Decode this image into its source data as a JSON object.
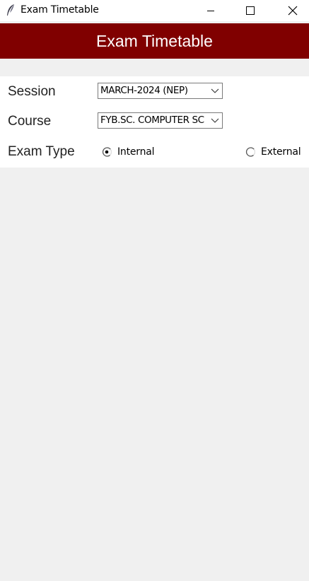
{
  "window": {
    "title": "Exam Timetable",
    "app_icon": "feather-icon",
    "controls": [
      "minimize-icon",
      "maximize-icon",
      "close-icon"
    ]
  },
  "header": {
    "title": "Exam Timetable",
    "background_color": "#800000",
    "text_color": "#ffffff"
  },
  "form": {
    "session": {
      "label": "Session",
      "selected": "MARCH-2024 (NEP)"
    },
    "course": {
      "label": "Course",
      "selected": "FYB.SC. COMPUTER SC"
    },
    "exam_type": {
      "label": "Exam Type",
      "options": [
        {
          "label": "Internal",
          "selected": true
        },
        {
          "label": "External",
          "selected": false
        }
      ]
    }
  }
}
